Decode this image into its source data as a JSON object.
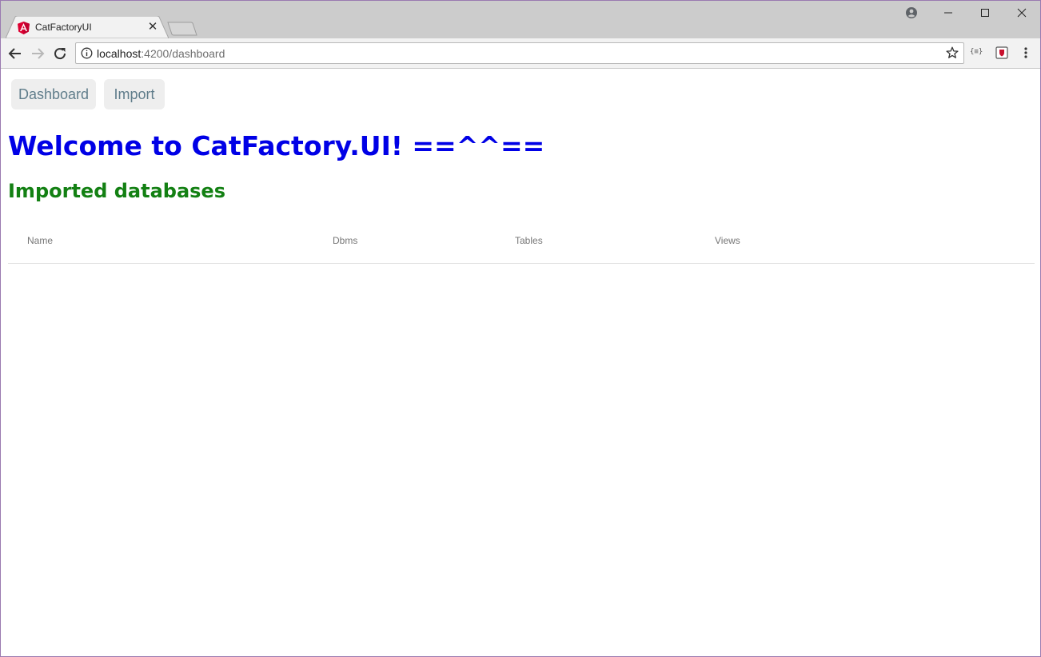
{
  "browser": {
    "tab_title": "CatFactoryUI",
    "url_host": "localhost",
    "url_path": ":4200/dashboard"
  },
  "nav": {
    "dashboard_label": "Dashboard",
    "import_label": "Import"
  },
  "page": {
    "title": "Welcome to CatFactory.UI! ==^^==",
    "subtitle": "Imported databases"
  },
  "table": {
    "columns": [
      "Name",
      "Dbms",
      "Tables",
      "Views"
    ],
    "rows": []
  },
  "colors": {
    "title": "#0000e6",
    "subtitle": "#138013",
    "nav_text": "#607d8b",
    "nav_bg": "#eeeeee"
  },
  "icons": {
    "favicon": "angular-logo-icon",
    "extension_1": "json-formatter-icon",
    "extension_2": "shield-extension-icon"
  }
}
